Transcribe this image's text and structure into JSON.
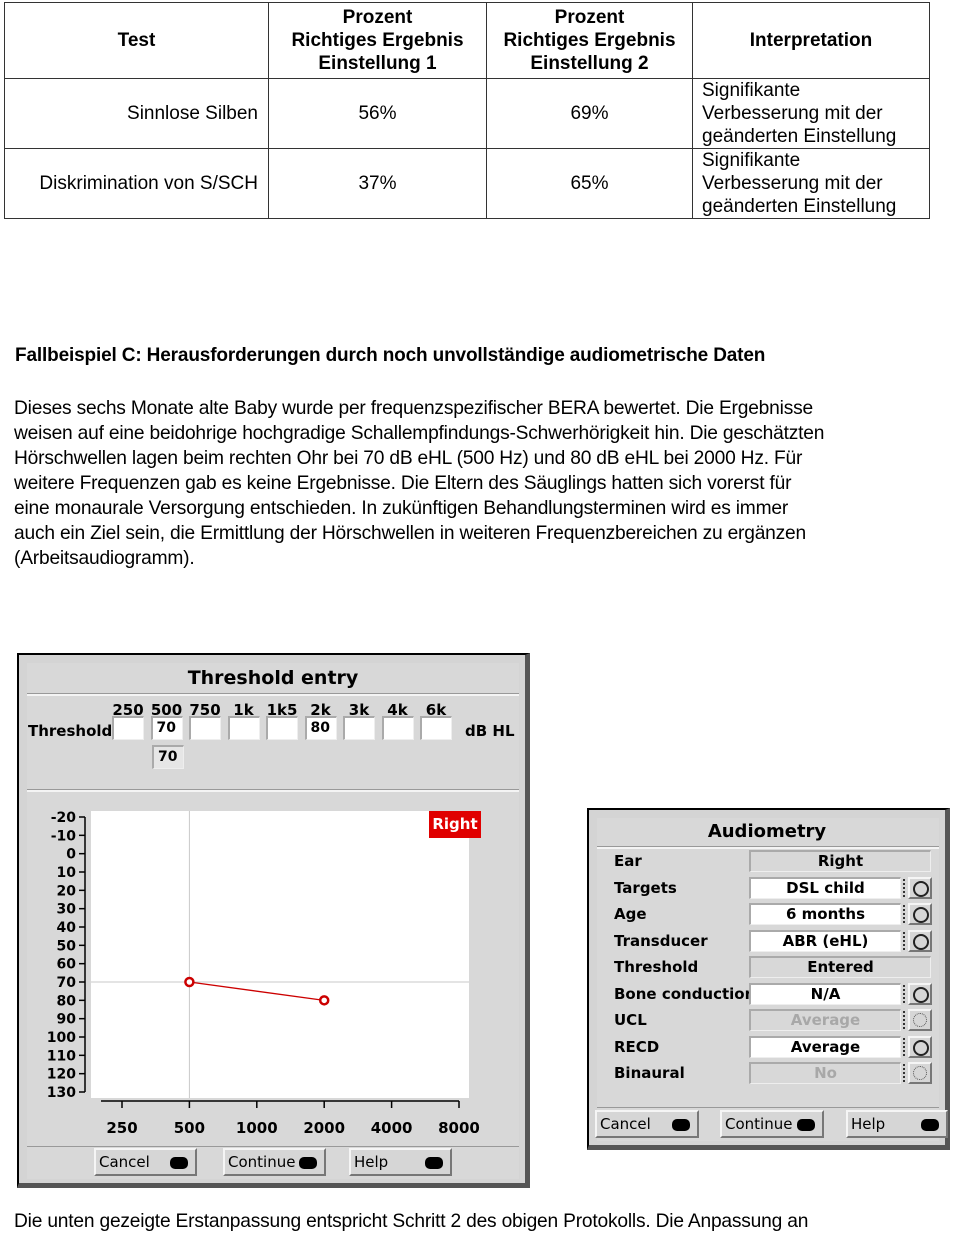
{
  "table": {
    "headers": [
      "Test",
      "Prozent\nRichtiges Ergebnis\nEinstellung 1",
      "Prozent\nRichtiges Ergebnis\nEinstellung 2",
      "Interpretation"
    ],
    "header_lines": [
      [
        "Test"
      ],
      [
        "Prozent",
        "Richtiges Ergebnis",
        "Einstellung 1"
      ],
      [
        "Prozent",
        "Richtiges Ergebnis",
        "Einstellung 2"
      ],
      [
        "Interpretation"
      ]
    ],
    "rows": [
      {
        "test": "Sinnlose Silben",
        "setting1": "56%",
        "setting2": "69%",
        "interpretation_lines": [
          "Signifikante",
          "Verbesserung mit der",
          "geänderten Einstellung"
        ]
      },
      {
        "test": "Diskrimination von S/SCH",
        "setting1": "37%",
        "setting2": "65%",
        "interpretation_lines": [
          "Signifikante",
          "Verbesserung mit der",
          "geänderten Einstellung"
        ]
      }
    ]
  },
  "case_heading": "Fallbeispiel C: Herausforderungen durch noch unvollständige audiometrische Daten",
  "paragraph_lines": [
    "Dieses sechs Monate alte Baby wurde per frequenzspezifischer BERA bewertet. Die Ergebnisse",
    "weisen auf eine beidohrige hochgradige Schallempfindungs-Schwerhörigkeit hin. Die geschätzten",
    "Hörschwellen lagen beim rechten Ohr bei 70 dB eHL (500 Hz) und 80 dB eHL bei 2000 Hz. Für",
    "weitere Frequenzen gab es keine Ergebnisse. Die Eltern des Säuglings hatten sich vorerst für",
    "eine monaurale Versorgung entschieden. In   zukünftigen Behandlungsterminen wird es immer",
    "auch ein Ziel sein, die Ermittlung der Hörschwellen in weiteren Frequenzbereichen zu ergänzen",
    "(Arbeitsaudiogramm)."
  ],
  "threshold_window": {
    "title": "Threshold entry",
    "row_label": "Threshold",
    "unit_label": "dB HL",
    "frequencies": [
      "250",
      "500",
      "750",
      "1k",
      "1k5",
      "2k",
      "3k",
      "4k",
      "6k"
    ],
    "values": [
      "",
      "70",
      "",
      "",
      "",
      "80",
      "",
      "",
      ""
    ],
    "second_row_value": "70",
    "buttons": {
      "cancel": "Cancel",
      "continue": "Continue",
      "help": "Help"
    }
  },
  "chart_data": {
    "type": "line",
    "title": "",
    "xlabel": "",
    "ylabel": "",
    "x_scale": "log",
    "x_ticks": [
      250,
      500,
      1000,
      2000,
      4000,
      8000
    ],
    "x_tick_labels": [
      "250",
      "500",
      "1000",
      "2000",
      "4000",
      "8000"
    ],
    "y_ticks": [
      -20,
      -10,
      0,
      10,
      20,
      30,
      40,
      50,
      60,
      70,
      80,
      90,
      100,
      110,
      120,
      130
    ],
    "y_tick_labels": [
      "-20",
      "-10",
      "0",
      "10",
      "20",
      "30",
      "40",
      "50",
      "60",
      "70",
      "80",
      "90",
      "100",
      "110",
      "120",
      "130"
    ],
    "ylim": [
      -20,
      130
    ],
    "xlim": [
      250,
      8000
    ],
    "y_inverted": true,
    "legend_badge": "Right",
    "series": [
      {
        "name": "Right",
        "color": "#cc0000",
        "x": [
          500,
          2000
        ],
        "y": [
          70,
          80
        ]
      }
    ],
    "crosshair": {
      "x": 500,
      "y": 70
    }
  },
  "audiometry_window": {
    "title": "Audiometry",
    "rows": [
      {
        "label": "Ear",
        "value": "Right",
        "type": "display"
      },
      {
        "label": "Targets",
        "value": "DSL child",
        "type": "select"
      },
      {
        "label": "Age",
        "value": "6 months",
        "type": "select"
      },
      {
        "label": "Transducer",
        "value": "ABR (eHL)",
        "type": "select"
      },
      {
        "label": "Threshold",
        "value": "Entered",
        "type": "display"
      },
      {
        "label": "Bone conduction",
        "value": "N/A",
        "type": "select"
      },
      {
        "label": "UCL",
        "value": "Average",
        "type": "disabled"
      },
      {
        "label": "RECD",
        "value": "Average",
        "type": "select"
      },
      {
        "label": "Binaural",
        "value": "No",
        "type": "disabled"
      }
    ],
    "buttons": {
      "cancel": "Cancel",
      "continue": "Continue",
      "help": "Help"
    }
  },
  "bottom_text": "Die unten gezeigte Erstanpassung entspricht Schritt 2 des obigen Protokolls. Die Anpassung an"
}
